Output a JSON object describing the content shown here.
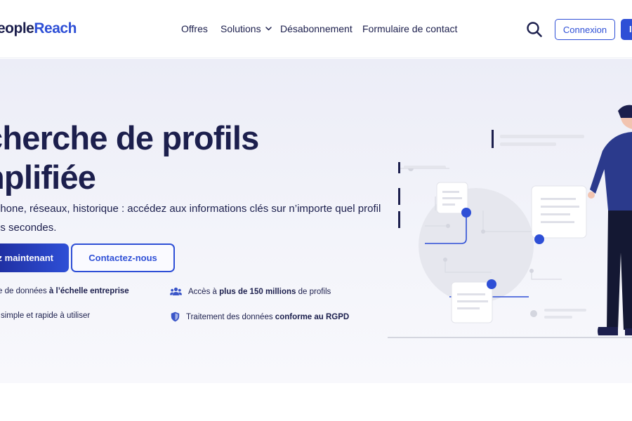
{
  "header": {
    "logo_part1": "eople",
    "logo_part2": "Reach",
    "nav": [
      {
        "label": "Offres"
      },
      {
        "label": "Solutions"
      },
      {
        "label": "Désabonnement"
      },
      {
        "label": "Formulaire de contact"
      }
    ],
    "login_label": "Connexion",
    "cta_partial": "I"
  },
  "hero": {
    "title_line1": "cherche de profils",
    "title_line2": "nplifiée",
    "subtitle_line1": "phone, réseaux, historique : accédez aux informations clés sur n’importe quel profil",
    "subtitle_line2": "es secondes.",
    "primary_button": "z maintenant",
    "secondary_button": "Contactez-nous",
    "features": [
      {
        "pre": "e de données ",
        "bold": "à l’échelle entreprise",
        "post": ""
      },
      {
        "pre": "Accès à ",
        "bold": "plus de 150 millions",
        "post": " de profils"
      },
      {
        "pre": "simple et rapide à utiliser",
        "bold": "",
        "post": ""
      },
      {
        "pre": "Traitement des données ",
        "bold": "conforme au RGPD",
        "post": ""
      }
    ]
  },
  "colors": {
    "brand": "#2e4fd6",
    "navy": "#1c1f4d"
  },
  "icons": [
    "search-icon",
    "chevron-down-icon",
    "users-icon",
    "shield-icon"
  ]
}
